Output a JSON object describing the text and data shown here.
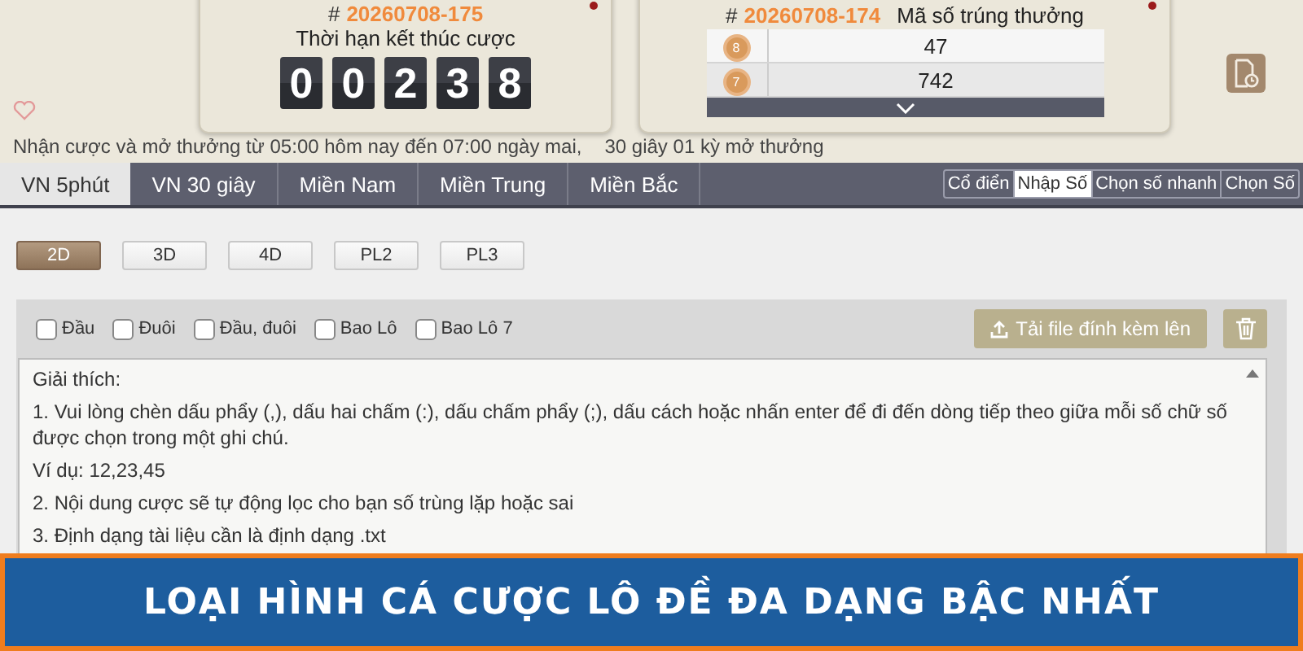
{
  "current_draw": {
    "hash": "#",
    "number": "20260708-175",
    "label": "Thời hạn kết thúc cược",
    "countdown": [
      "0",
      "0",
      "2",
      "3",
      "8"
    ]
  },
  "last_draw": {
    "hash": "#",
    "number": "20260708-174",
    "label": "Mã số trúng thưởng",
    "results": [
      {
        "ball": "8",
        "value": "47"
      },
      {
        "ball": "7",
        "value": "742"
      }
    ]
  },
  "info": {
    "hours": "Nhận cược và mở thưởng từ 05:00 hôm nay đến 07:00 ngày mai,",
    "interval": "30 giây 01 kỳ mở thưởng"
  },
  "tabs": [
    {
      "label": "VN 5phút",
      "selected": true
    },
    {
      "label": "VN 30 giây",
      "selected": false
    },
    {
      "label": "Miền Nam",
      "selected": false
    },
    {
      "label": "Miền Trung",
      "selected": false
    },
    {
      "label": "Miền Bắc",
      "selected": false
    }
  ],
  "modes": [
    {
      "label": "Cổ điển",
      "selected": false
    },
    {
      "label": "Nhập Số",
      "selected": true
    },
    {
      "label": "Chọn số nhanh",
      "selected": false
    },
    {
      "label": "Chọn Số",
      "selected": false
    }
  ],
  "game_types": [
    {
      "label": "2D",
      "selected": true
    },
    {
      "label": "3D",
      "selected": false
    },
    {
      "label": "4D",
      "selected": false
    },
    {
      "label": "PL2",
      "selected": false
    },
    {
      "label": "PL3",
      "selected": false
    }
  ],
  "options": [
    {
      "label": "Đầu",
      "checked": false
    },
    {
      "label": "Đuôi",
      "checked": false
    },
    {
      "label": "Đầu, đuôi",
      "checked": false
    },
    {
      "label": "Bao Lô",
      "checked": false
    },
    {
      "label": "Bao Lô 7",
      "checked": false
    }
  ],
  "upload_button": "Tải file đính kèm lên",
  "instructions": [
    "Giải thích:",
    "1. Vui lòng chèn dấu phẩy (,), dấu hai chấm (:), dấu chấm phẩy (;), dấu cách hoặc nhấn enter để đi đến dòng tiếp theo giữa mỗi số chữ số được chọn trong một ghi chú.",
    "Ví dụ: 12,23,45",
    "2. Nội dung cược sẽ tự động lọc cho bạn số trùng lặp hoặc sai",
    "3. Định dạng tài liệu cần là định dạng .txt"
  ],
  "banner": "LOẠI HÌNH CÁ CƯỢC LÔ ĐỀ ĐA DẠNG BẬC NHẤT"
}
